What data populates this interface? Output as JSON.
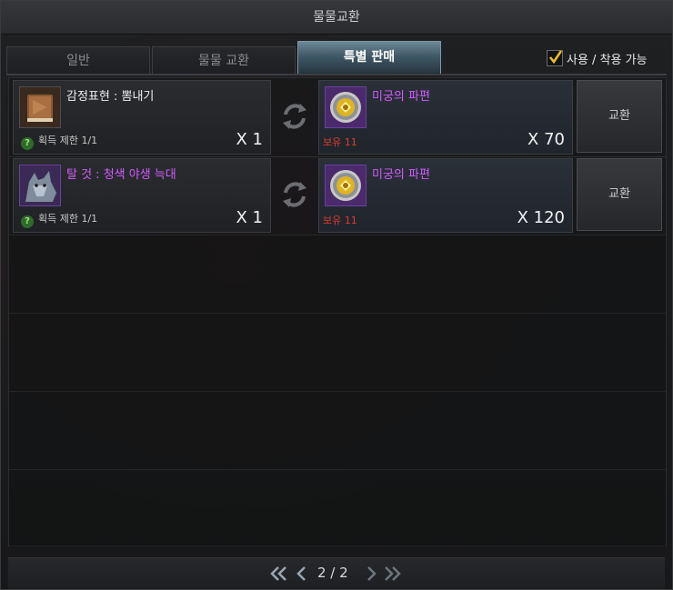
{
  "window": {
    "title": "물물교환"
  },
  "tabs": [
    {
      "label": "일반"
    },
    {
      "label": "물물 교환"
    },
    {
      "label": "특별 판매"
    }
  ],
  "filter": {
    "label": "사용 / 착용 가능",
    "checked": true
  },
  "items": [
    {
      "give_name": "감정표현 : 뽐내기",
      "give_limit": "획득 제한 1/1",
      "give_qty": "X 1",
      "give_icon": "book-icon",
      "get_name": "미궁의 파편",
      "get_own": "보유 11",
      "get_qty": "X 70",
      "get_icon": "labyrinth-shard-icon",
      "button": "교환"
    },
    {
      "give_name": "탈 것 : 청색 야생 늑대",
      "give_limit": "획득 제한 1/1",
      "give_qty": "X 1",
      "give_icon": "wolf-mount-icon",
      "get_name": "미궁의 파편",
      "get_own": "보유 11",
      "get_qty": "X 120",
      "get_icon": "labyrinth-shard-icon",
      "button": "교환"
    }
  ],
  "pager": {
    "text": "2 / 2"
  },
  "colors": {
    "accent_tab": "#5f7f90",
    "owned_red": "#e03c2c",
    "item_purple": "#d25cff",
    "check_yellow": "#f0c020"
  }
}
